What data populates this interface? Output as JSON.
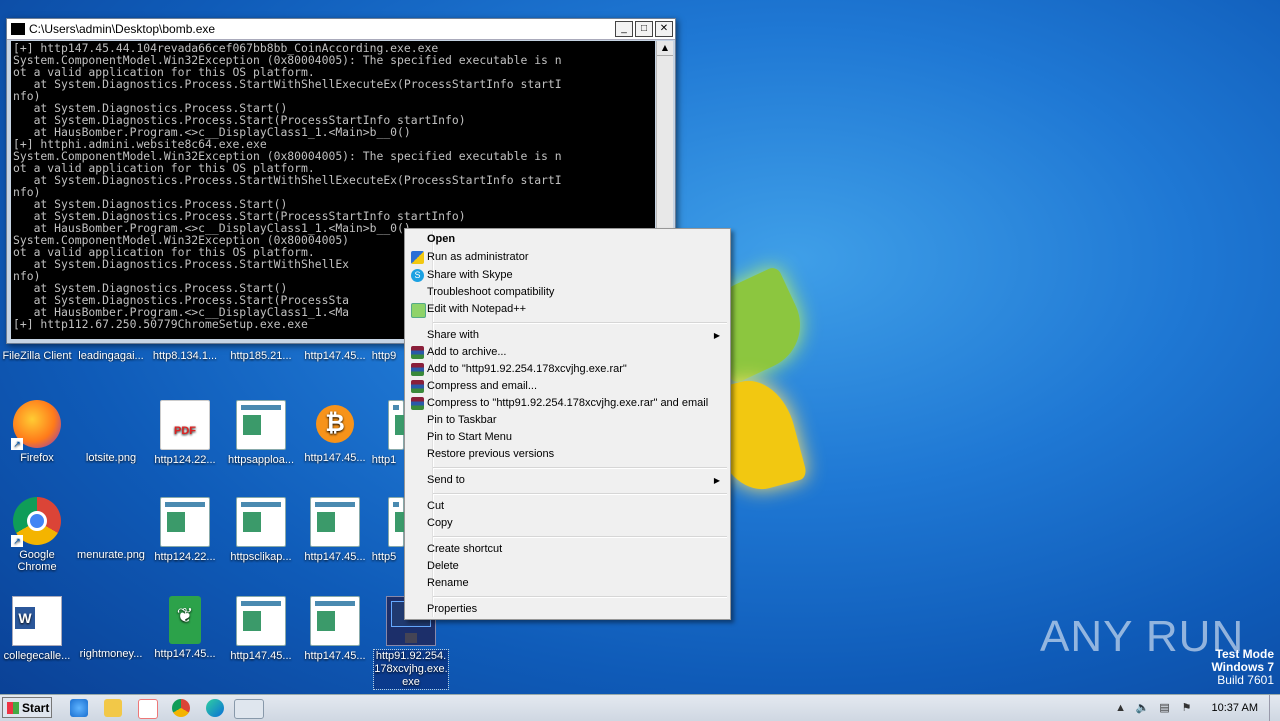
{
  "console": {
    "title": "C:\\Users\\admin\\Desktop\\bomb.exe",
    "lines": [
      "[+] http147.45.44.104revada66cef067bb8bb_CoinAccording.exe.exe",
      "System.ComponentModel.Win32Exception (0x80004005): The specified executable is n",
      "ot a valid application for this OS platform.",
      "   at System.Diagnostics.Process.StartWithShellExecuteEx(ProcessStartInfo startI",
      "nfo)",
      "   at System.Diagnostics.Process.Start()",
      "   at System.Diagnostics.Process.Start(ProcessStartInfo startInfo)",
      "   at HausBomber.Program.<>c__DisplayClass1_1.<Main>b__0()",
      "[+] httphi.admini.website8c64.exe.exe",
      "System.ComponentModel.Win32Exception (0x80004005): The specified executable is n",
      "ot a valid application for this OS platform.",
      "   at System.Diagnostics.Process.StartWithShellExecuteEx(ProcessStartInfo startI",
      "nfo)",
      "   at System.Diagnostics.Process.Start()",
      "   at System.Diagnostics.Process.Start(ProcessStartInfo startInfo)",
      "   at HausBomber.Program.<>c__DisplayClass1_1.<Main>b__0()",
      "System.ComponentModel.Win32Exception (0x80004005)",
      "ot a valid application for this OS platform.",
      "   at System.Diagnostics.Process.StartWithShellEx",
      "nfo)",
      "   at System.Diagnostics.Process.Start()",
      "   at System.Diagnostics.Process.Start(ProcessSta",
      "   at HausBomber.Program.<>c__DisplayClass1_1.<Ma",
      "[+] http112.67.250.50779ChromeSetup.exe.exe"
    ]
  },
  "context_menu": {
    "open": "Open",
    "run_as_admin": "Run as administrator",
    "share_skype": "Share with Skype",
    "troubleshoot": "Troubleshoot compatibility",
    "edit_notepad": "Edit with Notepad++",
    "share_with": "Share with",
    "add_archive": "Add to archive...",
    "add_to_rar": "Add to \"http91.92.254.178xcvjhg.exe.rar\"",
    "compress_email": "Compress and email...",
    "compress_rar_email": "Compress to \"http91.92.254.178xcvjhg.exe.rar\" and email",
    "pin_taskbar": "Pin to Taskbar",
    "pin_start": "Pin to Start Menu",
    "restore_versions": "Restore previous versions",
    "send_to": "Send to",
    "cut": "Cut",
    "copy": "Copy",
    "create_shortcut": "Create shortcut",
    "delete": "Delete",
    "rename": "Rename",
    "properties": "Properties"
  },
  "desktop": {
    "row1": [
      "FileZilla Client",
      "leadingagai...",
      "http8.134.1...",
      "http185.21...",
      "http147.45...",
      "http9"
    ],
    "row2": [
      "Firefox",
      "lotsite.png",
      "http124.22...",
      "httpsapploa...",
      "http147.45...",
      "http1"
    ],
    "row3": [
      "Google Chrome",
      "menurate.png",
      "http124.22...",
      "httpsclikap...",
      "http147.45...",
      "http5"
    ],
    "row4": [
      "collegecalle...",
      "rightmoney...",
      "http147.45...",
      "http147.45...",
      "http147.45..."
    ],
    "selected": "http91.92.254.178xcvjhg.exe.exe"
  },
  "watermark": "ANY  RUN",
  "testmode": {
    "line1": "Test Mode",
    "line2": "Windows 7",
    "line3": "Build 7601"
  },
  "taskbar": {
    "start": "Start",
    "clock": "10:37 AM"
  }
}
